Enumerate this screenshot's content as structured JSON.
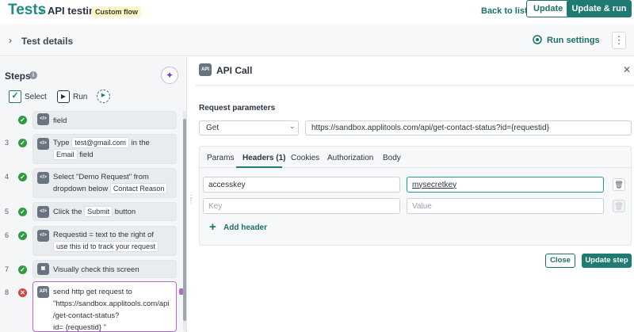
{
  "header": {
    "breadcrumb_root": "Tests",
    "breadcrumb_sep": "›",
    "page_title": "API testing",
    "badge": "Custom flow",
    "back_link": "Back to list",
    "update_label": "Update",
    "update_run_label": "Update & run"
  },
  "details": {
    "title": "Test details",
    "run_settings": "Run settings",
    "kebab": "⋮"
  },
  "steps_panel": {
    "title": "Steps",
    "toolbar": {
      "select": "Select",
      "run": "Run"
    },
    "steps": [
      {
        "number": "",
        "status": "pass",
        "partial_text": "field"
      },
      {
        "number": "3",
        "status": "pass",
        "prefix": "Type",
        "value": "test@gmail.com",
        "middle": "in the",
        "target": "Email",
        "suffix": "field"
      },
      {
        "number": "4",
        "status": "pass",
        "prefix": "Select \"Demo Request\" from dropdown below",
        "target": "Contact Reason"
      },
      {
        "number": "5",
        "status": "pass",
        "prefix": "Click the",
        "target": "Submit",
        "suffix": "button"
      },
      {
        "number": "6",
        "status": "pass",
        "prefix": "Requestid = text to the right of",
        "target": "use this id to track your request"
      },
      {
        "number": "7",
        "status": "pass",
        "text": "Visually check this screen"
      },
      {
        "number": "8",
        "status": "fail",
        "line1": "send http get request to",
        "line2": "\"https://sandbox.applitools.com/api",
        "line3": "/get-contact-status?",
        "line4": "id= {requestid} \""
      }
    ]
  },
  "api_panel": {
    "title": "API Call",
    "request_label": "Request parameters",
    "method": "Get",
    "url": "https://sandbox.applitools.com/api/get-contact-status?id={requestid}",
    "tabs": [
      {
        "label": "Params",
        "active": false
      },
      {
        "label": "Headers (1)",
        "active": true
      },
      {
        "label": "Cookies",
        "active": false
      },
      {
        "label": "Authorization",
        "active": false
      },
      {
        "label": "Body",
        "active": false
      }
    ],
    "headers": [
      {
        "key": "accesskey",
        "value": "mysecretkey"
      }
    ],
    "key_placeholder": "Key",
    "value_placeholder": "Value",
    "add_header": "Add header",
    "close_label": "Close",
    "update_step_label": "Update step"
  },
  "colors": {
    "brand": "#1f7b72",
    "pass": "#2f9a3e",
    "fail": "#d24545",
    "accent": "#b06cc9"
  }
}
